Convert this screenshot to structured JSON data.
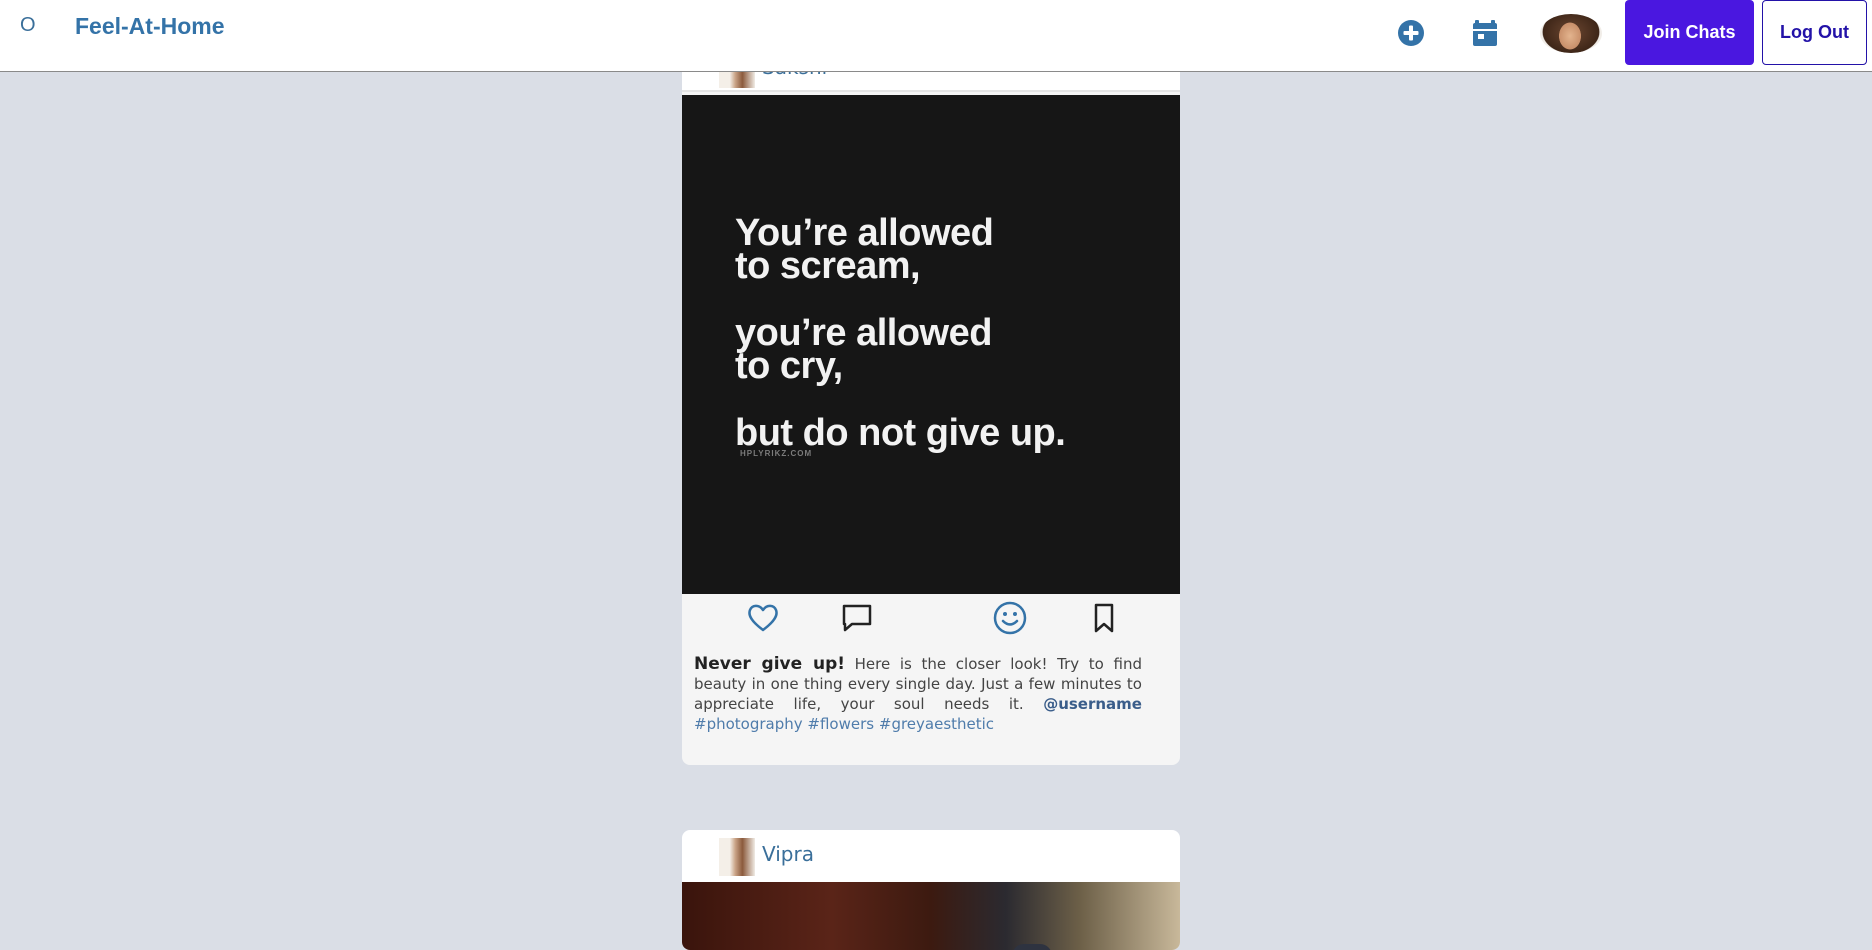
{
  "header": {
    "logo_glyph": "O",
    "brand": "Feel-At-Home",
    "join_label": "Join Chats",
    "logout_label": "Log Out",
    "colors": {
      "brand": "#3473a8",
      "join_bg": "#4a17e0",
      "logout_text": "#2312a8"
    },
    "icons": [
      "plus-circle-icon",
      "calendar-icon",
      "avatar"
    ]
  },
  "posts": [
    {
      "username": "Sakshi",
      "image": {
        "quote_lines_1": "You’re allowed\nto scream,",
        "quote_lines_2": "you’re allowed\nto cry,",
        "quote_lines_3": "but do not give up.",
        "watermark": "HPLYRIKZ.COM"
      },
      "actions": [
        "heart-icon",
        "comment-icon",
        "smiley-icon",
        "bookmark-icon"
      ],
      "caption": {
        "lead": "Never give up!",
        "text": " Here is the closer look! Try to find beauty in one thing every single day. Just a few minutes to appreciate life, your soul needs it. ",
        "mention": "@username",
        "tags": [
          "#photography",
          "#flowers",
          "#greyaesthetic"
        ]
      }
    },
    {
      "username": "Vipra"
    }
  ]
}
